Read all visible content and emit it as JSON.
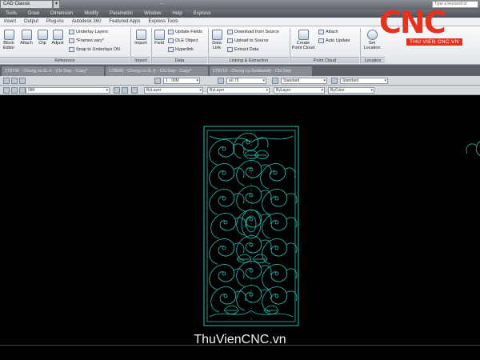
{
  "titlebar": {
    "workspace": "CAD Classic",
    "document": "...",
    "search_placeholder": "Type a keyword or phrase"
  },
  "menu": [
    "Tools",
    "Draw",
    "Dimension",
    "Modify",
    "Parametric",
    "Window",
    "Help",
    "Express"
  ],
  "ribbon_tabs": [
    "Insert",
    "Output",
    "Plug-ins",
    "Autodesk 360",
    "Featured Apps",
    "Express Tools"
  ],
  "ribbon": {
    "block_editor": "Block Editor",
    "attach": "Attach",
    "clip": "Clip",
    "adjust": "Adjust",
    "underlay_layers": "Underlay Layers",
    "frames_vary": "*Frames vary*",
    "snap_to_underlays": "Snap to Underlays ON",
    "reference_panel": "Reference",
    "import": "Import",
    "import_panel": "Import",
    "field": "Field",
    "update_fields": "Update Fields",
    "ole_object": "OLE Object",
    "hyperlink": "Hyperlink",
    "data_panel": "Data",
    "data_link": "Data Link",
    "download_from_source": "Download from Source",
    "upload_to_source": "Upload to Source",
    "extract_data": "Extract Data",
    "linking_panel": "Linking & Extraction",
    "create_point_cloud": "Create Point Cloud",
    "attach_pc": "Attach",
    "auto_update": "Auto Update",
    "point_cloud_panel": "Point Cloud",
    "set_location": "Set Location",
    "location_panel": "Location"
  },
  "doc_tabs": [
    "178736 - Chong cu G..h - Chi Dep - Copy*",
    "178905 - Chong cu G..h - Chi Dep - Copy*",
    "179713 - Chong cu Goldsmith - Chi Dep"
  ],
  "toolbar1": {
    "dimstyle": "1 : 00M",
    "textsize": "a0.75",
    "textstyle": "Standard",
    "tablestyle": "Standard"
  },
  "toolbar2": {
    "layer": "0IM",
    "color": "ByLayer",
    "linetype": "ByLayer",
    "lineweight": "ByLayer",
    "plotstyle": "ByColor"
  },
  "logo": {
    "brand": "CNC",
    "subtitle": "THU VIEN CNC.VN"
  },
  "watermark": "ThuVienCNC.vn",
  "colors": {
    "accent": "#e4321e",
    "drawing": "#2fbfb4",
    "background": "#000000"
  }
}
